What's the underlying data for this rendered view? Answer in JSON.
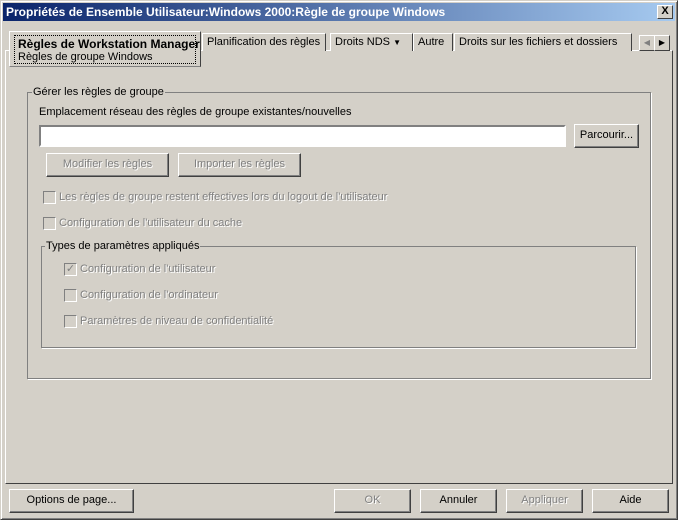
{
  "window": {
    "title": "Propriétés de Ensemble Utilisateur:Windows 2000:Règle de groupe Windows",
    "close": "X"
  },
  "tabs": [
    {
      "label": "Règles de Workstation Manager",
      "sublabel": "Règles de groupe Windows"
    },
    {
      "label": "Planification des règles"
    },
    {
      "label": "Droits NDS",
      "dropdown": "▼"
    },
    {
      "label": "Autre"
    },
    {
      "label": "Droits sur les fichiers et dossiers"
    }
  ],
  "tab_scroll": {
    "left": "◀",
    "right": "▶"
  },
  "group": {
    "title": "Gérer les règles de groupe",
    "location_label": "Emplacement réseau des règles de groupe existantes/nouvelles",
    "location_value": "",
    "browse": "Parcourir...",
    "modify": "Modifier les règles",
    "import": "Importer les règles",
    "cb_effective": "Les règles de groupe restent effectives lors du logout de l'utilisateur",
    "cb_cache": "Configuration de l'utilisateur du cache",
    "types": {
      "title": "Types de paramètres appliqués",
      "user": "Configuration de l'utilisateur",
      "user_checked": true,
      "computer": "Configuration de l'ordinateur",
      "privacy": "Paramètres de niveau de confidentialité"
    }
  },
  "footer": {
    "options": "Options de page...",
    "ok": "OK",
    "cancel": "Annuler",
    "apply": "Appliquer",
    "help": "Aide"
  }
}
